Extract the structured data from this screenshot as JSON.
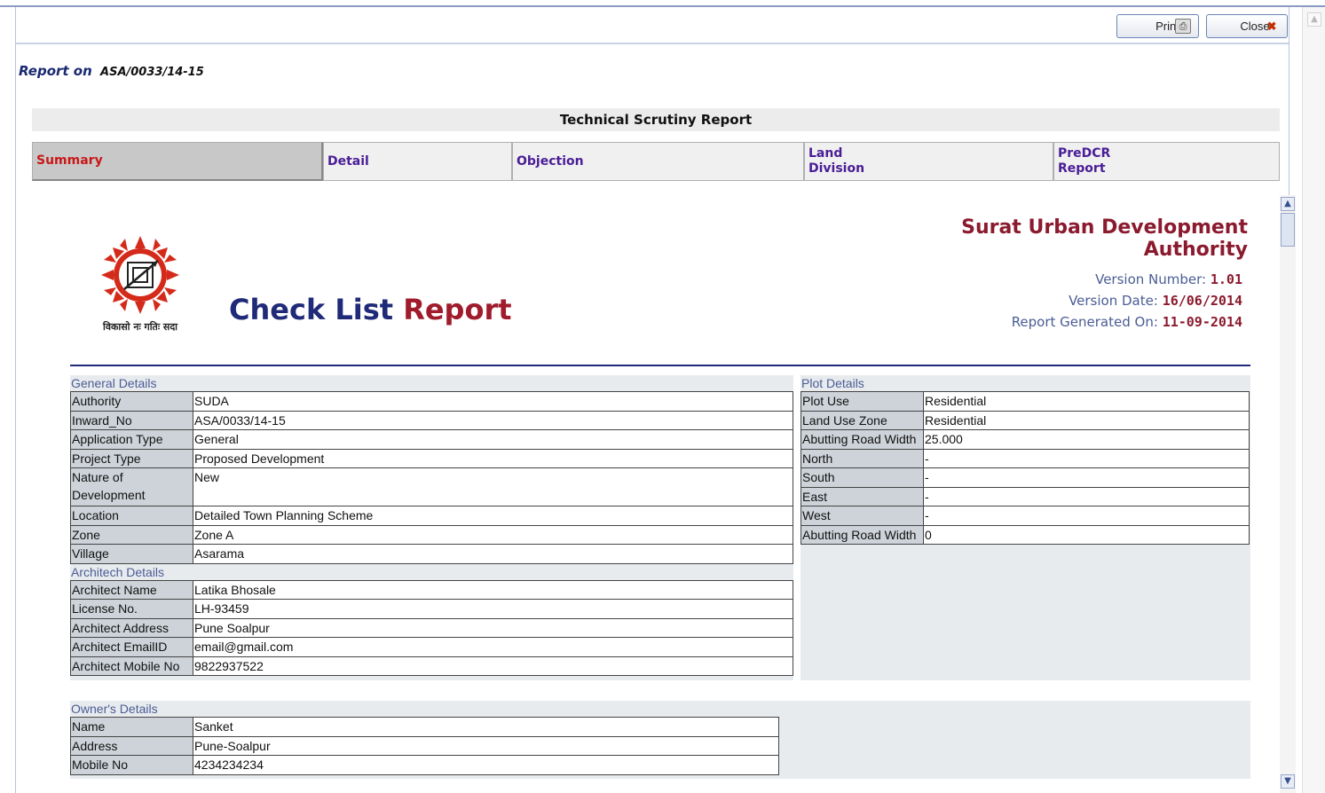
{
  "toolbar": {
    "print_label": "Print",
    "close_label": "Close"
  },
  "report_on": {
    "label": "Report on",
    "id": "ASA/0033/14-15"
  },
  "section_header": "Technical Scrutiny Report",
  "tabs": [
    {
      "label": "Summary"
    },
    {
      "label": "Detail"
    },
    {
      "label": "Objection"
    },
    {
      "label": "Land Division"
    },
    {
      "label": "PreDCR Report"
    }
  ],
  "report": {
    "title_part1": "Check List",
    "title_part2": "Report",
    "authority_name": "Surat Urban Development Authority",
    "version_number_label": "Version Number:",
    "version_number": "1.01",
    "version_date_label": "Version Date:",
    "version_date": "16/06/2014",
    "generated_label": "Report Generated On:",
    "generated_on": "11-09-2014",
    "logo_motto": "विकासो नः गतिः सदा"
  },
  "general_details": {
    "title": "General Details",
    "rows": [
      {
        "k": "Authority",
        "v": "SUDA"
      },
      {
        "k": "Inward_No",
        "v": "ASA/0033/14-15"
      },
      {
        "k": "Application Type",
        "v": "General"
      },
      {
        "k": "Project Type",
        "v": "Proposed Development"
      },
      {
        "k": "Nature of Development",
        "v": "New"
      },
      {
        "k": "Location",
        "v": "Detailed Town Planning Scheme"
      },
      {
        "k": "Zone",
        "v": "Zone A"
      },
      {
        "k": "Village",
        "v": "Asarama"
      }
    ]
  },
  "architect_details": {
    "title": "Architech Details",
    "rows": [
      {
        "k": "Architect Name",
        "v": "Latika Bhosale"
      },
      {
        "k": "License No.",
        "v": "LH-93459"
      },
      {
        "k": "Architect Address",
        "v": "Pune Soalpur"
      },
      {
        "k": "Architect EmailID",
        "v": "email@gmail.com"
      },
      {
        "k": "Architect Mobile No",
        "v": "9822937522"
      }
    ]
  },
  "plot_details": {
    "title": "Plot Details",
    "rows": [
      {
        "k": "Plot Use",
        "v": "Residential"
      },
      {
        "k": "Land Use Zone",
        "v": "Residential"
      },
      {
        "k": "Abutting Road Width",
        "v": "25.000"
      },
      {
        "k": "North",
        "v": "-"
      },
      {
        "k": "South",
        "v": "-"
      },
      {
        "k": "East",
        "v": "-"
      },
      {
        "k": "West",
        "v": "-"
      },
      {
        "k": "Abutting Road Width",
        "v": "0"
      }
    ]
  },
  "owner_details": {
    "title": "Owner's Details",
    "rows": [
      {
        "k": "Name",
        "v": "Sanket"
      },
      {
        "k": "Address",
        "v": "Pune-Soalpur"
      },
      {
        "k": "Mobile No",
        "v": "4234234234"
      }
    ]
  }
}
